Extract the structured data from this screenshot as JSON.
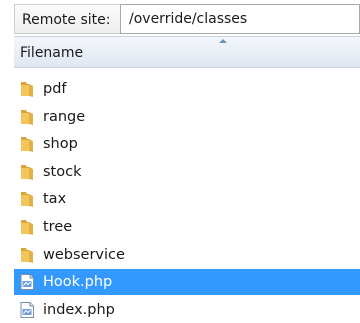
{
  "site": {
    "label": "Remote site:",
    "path": "/override/classes"
  },
  "columns": {
    "filename": "Filename"
  },
  "files": [
    {
      "name": "pdf",
      "type": "folder",
      "icon": "folder-icon"
    },
    {
      "name": "range",
      "type": "folder",
      "icon": "folder-icon"
    },
    {
      "name": "shop",
      "type": "folder",
      "icon": "folder-icon"
    },
    {
      "name": "stock",
      "type": "folder",
      "icon": "folder-icon"
    },
    {
      "name": "tax",
      "type": "folder",
      "icon": "folder-icon"
    },
    {
      "name": "tree",
      "type": "folder",
      "icon": "folder-icon"
    },
    {
      "name": "webservice",
      "type": "folder",
      "icon": "folder-icon"
    },
    {
      "name": "Hook.php",
      "type": "file",
      "icon": "php-file-icon",
      "selected": true
    },
    {
      "name": "index.php",
      "type": "file",
      "icon": "php-file-icon"
    }
  ],
  "colors": {
    "selection": "#3399ff",
    "folder": "#e8b84a",
    "header_bg": "#dfe7f2"
  }
}
